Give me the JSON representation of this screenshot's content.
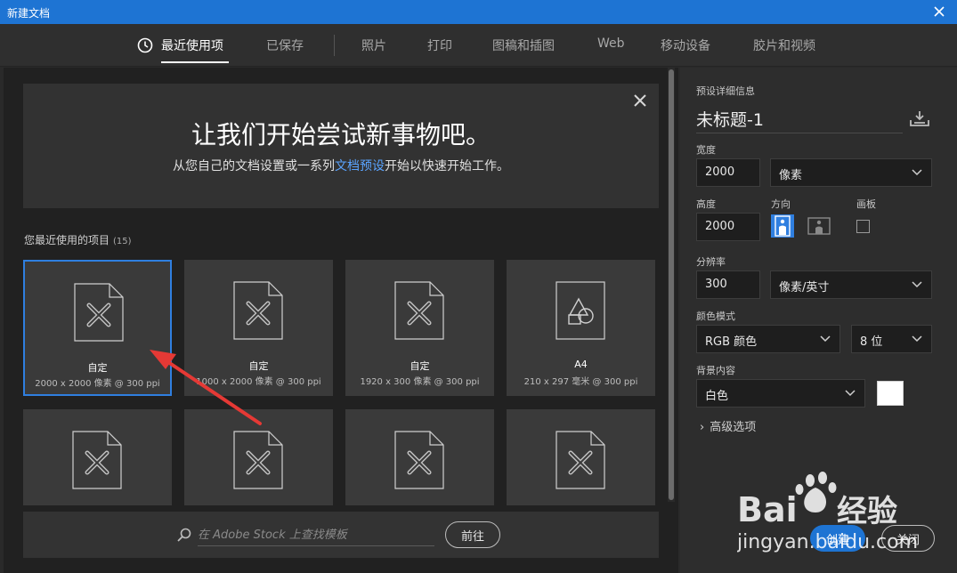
{
  "window": {
    "title": "新建文档"
  },
  "tabs": [
    {
      "label": "最近使用项",
      "active": true
    },
    {
      "label": "已保存"
    },
    {
      "label": "照片"
    },
    {
      "label": "打印"
    },
    {
      "label": "图稿和插图"
    },
    {
      "label": "Web"
    },
    {
      "label": "移动设备"
    },
    {
      "label": "胶片和视频"
    }
  ],
  "banner": {
    "headline": "让我们开始尝试新事物吧。",
    "sub_before": "从您自己的文档设置或一系列",
    "sub_link": "文档预设",
    "sub_after": "开始以快速开始工作。"
  },
  "recent": {
    "label": "您最近使用的项目",
    "count": "(15)",
    "items": [
      {
        "name": "自定",
        "desc": "2000 x 2000 像素 @ 300 ppi",
        "icon": "custom-doc-icon",
        "selected": true
      },
      {
        "name": "自定",
        "desc": "1000 x 2000 像素 @ 300 ppi",
        "icon": "custom-doc-icon"
      },
      {
        "name": "自定",
        "desc": "1920 x 300 像素 @ 300 ppi",
        "icon": "custom-doc-icon"
      },
      {
        "name": "A4",
        "desc": "210 x 297 毫米 @ 300 ppi",
        "icon": "shapes-doc-icon"
      },
      {
        "name": "",
        "desc": "",
        "icon": "custom-doc-icon"
      },
      {
        "name": "",
        "desc": "",
        "icon": "custom-doc-icon"
      },
      {
        "name": "",
        "desc": "",
        "icon": "custom-doc-icon"
      },
      {
        "name": "",
        "desc": "",
        "icon": "custom-doc-icon"
      }
    ]
  },
  "search": {
    "placeholder": "在 Adobe Stock 上查找模板",
    "go_label": "前往"
  },
  "preset": {
    "section_label": "预设详细信息",
    "doc_name": "未标题-1",
    "width_label": "宽度",
    "width_value": "2000",
    "width_unit": "像素",
    "height_label": "高度",
    "height_value": "2000",
    "orientation_label": "方向",
    "artboard_label": "画板",
    "resolution_label": "分辨率",
    "resolution_value": "300",
    "resolution_unit": "像素/英寸",
    "color_mode_label": "颜色模式",
    "color_mode": "RGB 颜色",
    "bit_depth": "8 位",
    "background_label": "背景内容",
    "background": "白色",
    "background_color": "#ffffff",
    "advanced_label": "高级选项"
  },
  "actions": {
    "create_label": "创建",
    "close_label": "关闭"
  },
  "watermark": {
    "brand": "Bai du 经验",
    "url": "jingyan.baidu.com"
  },
  "colors": {
    "accent": "#1e74d3",
    "selected_border": "#2f7fe0",
    "link": "#5aa4ff",
    "annotation_arrow": "#e53935"
  }
}
